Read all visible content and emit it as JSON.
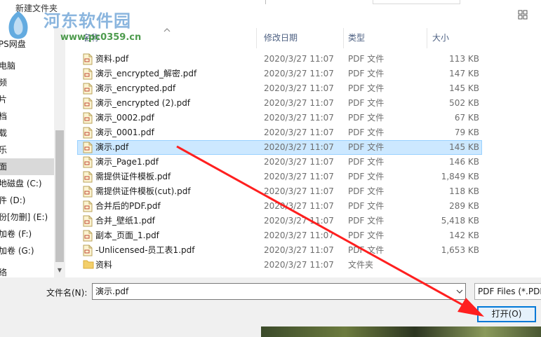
{
  "toolbar": {
    "new_folder_label": "新建文件夹"
  },
  "watermark": {
    "title": "河东软件园",
    "url": "www.pc0359.cn"
  },
  "nav": {
    "items": [
      {
        "label": "WPS网盘",
        "selected": false
      },
      {
        "label": "此电脑",
        "selected": false
      },
      {
        "label": "视频",
        "selected": false
      },
      {
        "label": "图片",
        "selected": false
      },
      {
        "label": "文档",
        "selected": false
      },
      {
        "label": "下载",
        "selected": false
      },
      {
        "label": "音乐",
        "selected": false
      },
      {
        "label": "桌面",
        "selected": true
      },
      {
        "label": "本地磁盘 (C:)",
        "selected": false
      },
      {
        "label": "软件 (D:)",
        "selected": false
      },
      {
        "label": "备份[勿删] (E:)",
        "selected": false
      },
      {
        "label": "新加卷 (F:)",
        "selected": false
      },
      {
        "label": "新加卷 (G:)",
        "selected": false
      },
      {
        "label": "网络",
        "selected": false
      }
    ]
  },
  "columns": {
    "name": "名称",
    "date": "修改日期",
    "type": "类型",
    "size": "大小"
  },
  "files": [
    {
      "name": "资料.pdf",
      "date": "2020/3/27 11:07",
      "type": "PDF 文件",
      "size": "113 KB",
      "kind": "pdf",
      "selected": false
    },
    {
      "name": "演示_encrypted_解密.pdf",
      "date": "2020/3/27 11:07",
      "type": "PDF 文件",
      "size": "147 KB",
      "kind": "pdf",
      "selected": false
    },
    {
      "name": "演示_encrypted.pdf",
      "date": "2020/3/27 11:07",
      "type": "PDF 文件",
      "size": "145 KB",
      "kind": "pdf",
      "selected": false
    },
    {
      "name": "演示_encrypted (2).pdf",
      "date": "2020/3/27 11:07",
      "type": "PDF 文件",
      "size": "502 KB",
      "kind": "pdf",
      "selected": false
    },
    {
      "name": "演示_0002.pdf",
      "date": "2020/3/27 11:07",
      "type": "PDF 文件",
      "size": "67 KB",
      "kind": "pdf",
      "selected": false
    },
    {
      "name": "演示_0001.pdf",
      "date": "2020/3/27 11:07",
      "type": "PDF 文件",
      "size": "79 KB",
      "kind": "pdf",
      "selected": false
    },
    {
      "name": "演示.pdf",
      "date": "2020/3/27 11:07",
      "type": "PDF 文件",
      "size": "145 KB",
      "kind": "pdf",
      "selected": true
    },
    {
      "name": "演示_Page1.pdf",
      "date": "2020/3/27 11:07",
      "type": "PDF 文件",
      "size": "146 KB",
      "kind": "pdf",
      "selected": false
    },
    {
      "name": "需提供证件模板.pdf",
      "date": "2020/3/27 11:07",
      "type": "PDF 文件",
      "size": "1,849 KB",
      "kind": "pdf",
      "selected": false
    },
    {
      "name": "需提供证件模板(cut).pdf",
      "date": "2020/3/27 11:07",
      "type": "PDF 文件",
      "size": "118 KB",
      "kind": "pdf",
      "selected": false
    },
    {
      "name": "合并后的PDF.pdf",
      "date": "2020/3/27 11:07",
      "type": "PDF 文件",
      "size": "289 KB",
      "kind": "pdf",
      "selected": false
    },
    {
      "name": "合并_壁纸1.pdf",
      "date": "2020/3/27 11:07",
      "type": "PDF 文件",
      "size": "5,418 KB",
      "kind": "pdf",
      "selected": false
    },
    {
      "name": "副本_页面_1.pdf",
      "date": "2020/3/27 11:07",
      "type": "PDF 文件",
      "size": "142 KB",
      "kind": "pdf",
      "selected": false
    },
    {
      "name": "-Unlicensed-员工表1.pdf",
      "date": "2020/3/27 11:07",
      "type": "PDF 文件",
      "size": "1,653 KB",
      "kind": "pdf",
      "selected": false
    },
    {
      "name": "资料",
      "date": "2020/3/27 11:07",
      "type": "文件夹",
      "size": "",
      "kind": "folder",
      "selected": false
    }
  ],
  "bottom": {
    "filename_label": "文件名(N):",
    "filename_value": "演示.pdf",
    "filter_label": "PDF Files (*.PDF)",
    "open_label": "打开(O)"
  },
  "colors": {
    "selection_bg": "#cce8ff",
    "selection_border": "#99d1ff",
    "accent": "#0078d7",
    "annotation_arrow": "#ff1f1f"
  }
}
